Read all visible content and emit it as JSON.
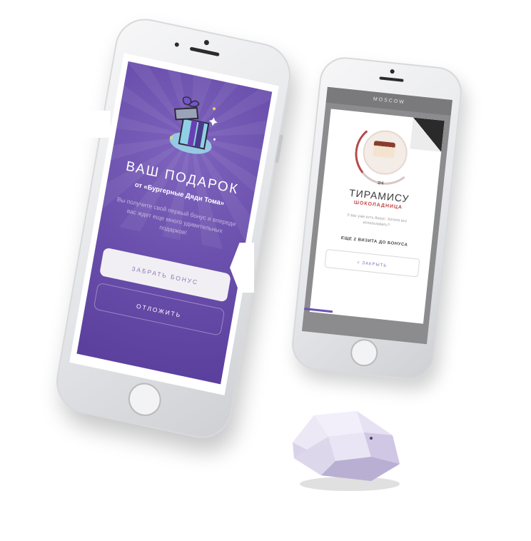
{
  "main_phone": {
    "promo": {
      "title": "ВАШ ПОДАРОК",
      "subtitle": "от «Бургерные Дяди Тома»",
      "description": "Вы получите свой первый бонус и впереди вас ждет еще много удивительных подарков!",
      "take_button": "ЗАБРАТЬ БОНУС",
      "later_button": "ОТЛОЖИТЬ"
    },
    "colors": {
      "promo_bg": "#6b50ad",
      "button_light": "#f1eff4"
    }
  },
  "second_phone": {
    "topbar": "MOSCOW",
    "card": {
      "progress_label": "2/4",
      "title": "ТИРАМИСУ",
      "subtitle": "ШОКОЛАДНИЦА",
      "description": "У вас уже есть бонус. Хотите его использовать?",
      "progress_text": "ЕЩЕ 2 ВИЗИТА ДО БОНУСА",
      "close_button": "< ЗАКРЫТЬ"
    },
    "colors": {
      "accent": "#c24343",
      "button_text": "#7b74b6"
    }
  },
  "icons": {
    "gift": "gift-icon",
    "dessert": "cake-icon",
    "beacon": "beacon-device"
  }
}
